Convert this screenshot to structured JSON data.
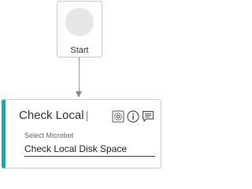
{
  "start_node": {
    "label": "Start",
    "icon": "circle-placeholder-icon"
  },
  "task_node": {
    "title": "Check Local",
    "accent_color": "#1aa7b4",
    "icons": [
      "gear-icon",
      "info-icon",
      "comment-icon"
    ],
    "field_label": "Select Microbot",
    "field_value": "Check Local Disk Space"
  }
}
